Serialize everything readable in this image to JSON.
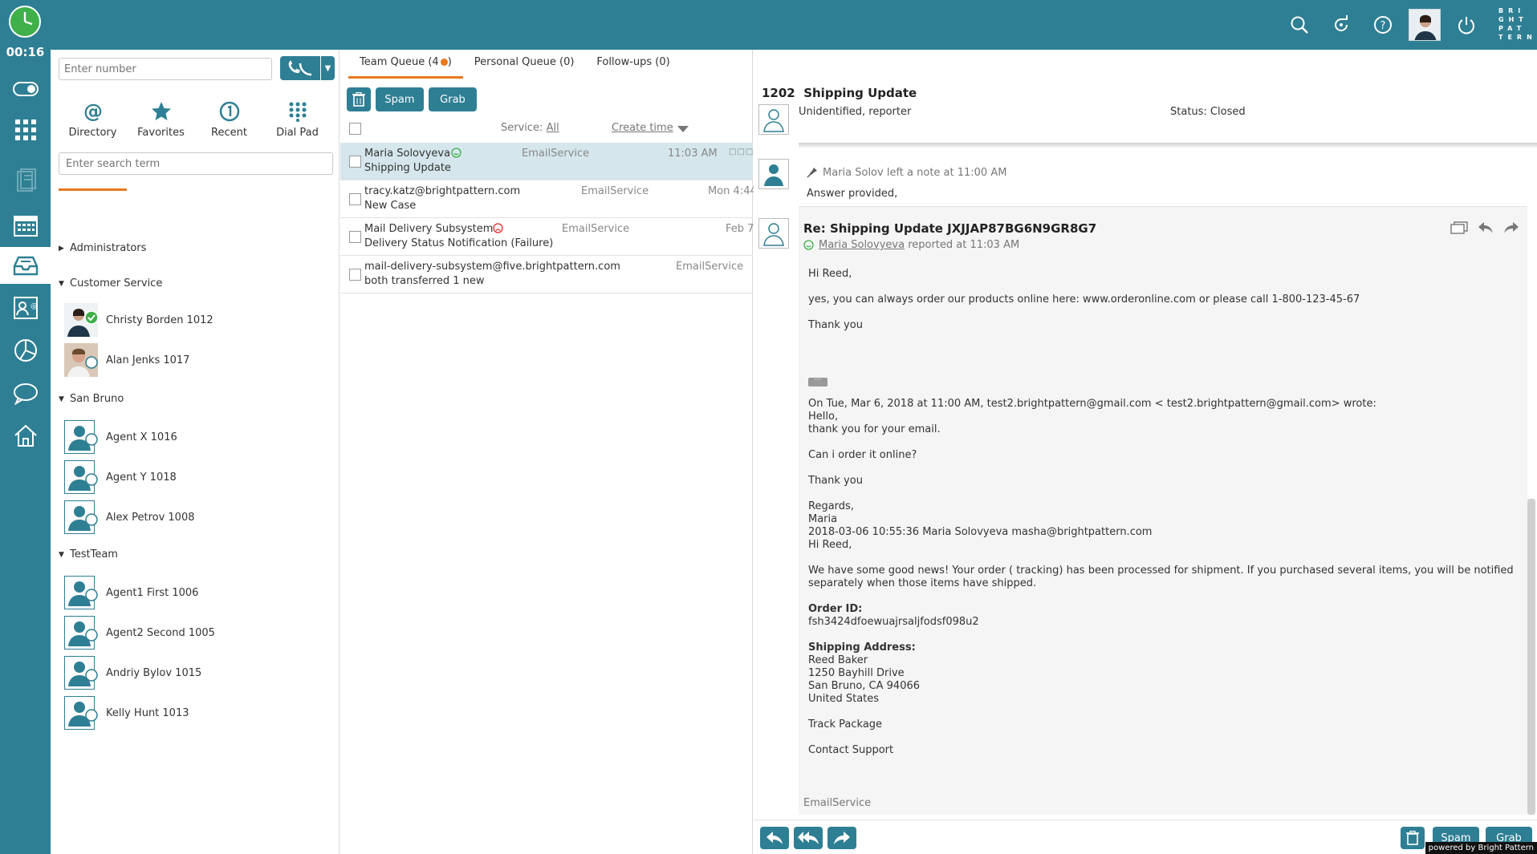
{
  "app": {
    "timer": "00:16",
    "logo_text": "BRI GHT PAT TERN"
  },
  "dialer": {
    "number_placeholder": "Enter number",
    "tabs": [
      {
        "label": "Directory",
        "icon": "at-icon"
      },
      {
        "label": "Favorites",
        "icon": "star-icon"
      },
      {
        "label": "Recent",
        "icon": "recent-icon"
      },
      {
        "label": "Dial Pad",
        "icon": "dialpad-icon"
      }
    ],
    "search_placeholder": "Enter search term"
  },
  "directory": {
    "groups": [
      {
        "name": "Administrators",
        "expanded": false,
        "agents": []
      },
      {
        "name": "Customer Service",
        "expanded": true,
        "agents": [
          {
            "name": "Christy Borden 1012",
            "status": "available"
          },
          {
            "name": "Alan Jenks 1017",
            "status": "offline"
          }
        ]
      },
      {
        "name": "San Bruno",
        "expanded": true,
        "agents": [
          {
            "name": "Agent X 1016",
            "status": "offline"
          },
          {
            "name": "Agent Y 1018",
            "status": "offline"
          },
          {
            "name": "Alex Petrov 1008",
            "status": "offline"
          }
        ]
      },
      {
        "name": "TestTeam",
        "expanded": true,
        "agents": [
          {
            "name": "Agent1 First 1006",
            "status": "offline"
          },
          {
            "name": "Agent2 Second 1005",
            "status": "offline"
          },
          {
            "name": "Andriy Bylov 1015",
            "status": "offline"
          },
          {
            "name": "Kelly Hunt 1013",
            "status": "offline"
          }
        ]
      }
    ]
  },
  "queue": {
    "tabs": [
      {
        "label": "Team Queue (4",
        "suffix": ")"
      },
      {
        "label": "Personal Queue (0)"
      },
      {
        "label": "Follow-ups (0)"
      }
    ],
    "spam_label": "Spam",
    "grab_label": "Grab",
    "service_label": "Service:",
    "service_value": "All",
    "sort_label": "Create time",
    "rows": [
      {
        "from": "Maria Solovyeva",
        "subject": "Shipping Update",
        "service": "EmailService",
        "time": "11:03 AM",
        "mood": "happy"
      },
      {
        "from": "tracy.katz@brightpattern.com",
        "subject": "New Case",
        "service": "EmailService",
        "time": "Mon 4:44"
      },
      {
        "from": "Mail Delivery Subsystem",
        "subject": "Delivery Status Notification (Failure)",
        "service": "EmailService",
        "time": "Feb 7",
        "mood": "sad"
      },
      {
        "from": "mail-delivery-subsystem@five.brightpattern.com",
        "subject": "both transferred 1 new",
        "service": "EmailService",
        "time": ""
      }
    ]
  },
  "case": {
    "number": "1202",
    "title": "Shipping Update",
    "contact": "Unidentified, reporter",
    "status": "Status: Closed",
    "note_by": "Maria Solov left a note at 11:00 AM",
    "note_text": "Answer provided,",
    "mail_subject": "Re: Shipping Update JXJJAP87BG6N9GR8G7",
    "mail_reporter": "Maria Solovyeva",
    "mail_reported": "reported at 11:03 AM",
    "body": {
      "l1": "Hi Reed,",
      "l2": "yes, you can always order our products online here: www.orderonline.com or please call 1-800-123-45-67",
      "l3": "Thank you",
      "q1": "On Tue, Mar 6, 2018 at 11:00 AM, test2.brightpattern@gmail.com < test2.brightpattern@gmail.com> wrote:",
      "q2": "Hello,",
      "q3": "thank you for your email.",
      "q4": "Can i order it online?",
      "q5": "Thank you",
      "q6": "Regards,",
      "q7": "Maria",
      "q8": "2018-03-06 10:55:36 Maria Solovyeva masha@brightpattern.com",
      "q9": "Hi Reed,",
      "q10": "We have some good news! Your order ( tracking) has been processed for shipment. If you purchased several items, you will be notified separately when those items have shipped.",
      "order_label": "Order ID:",
      "order_id": "fsh3424dfoewuajrsaljfodsf098u2",
      "ship_label": "Shipping Address:",
      "a1": "Reed Baker",
      "a2": "1250 Bayhill Drive",
      "a3": "San Bruno, CA 94066",
      "a4": "United States",
      "track": "Track Package",
      "contact": "Contact Support"
    },
    "service_footer": "EmailService",
    "bottom_spam": "Spam",
    "bottom_grab": "Grab",
    "powered": "powered by Bright Pattern"
  },
  "colors": {
    "accent": "#2e7f94",
    "highlight": "#e8781e",
    "available": "#3fb04a"
  }
}
